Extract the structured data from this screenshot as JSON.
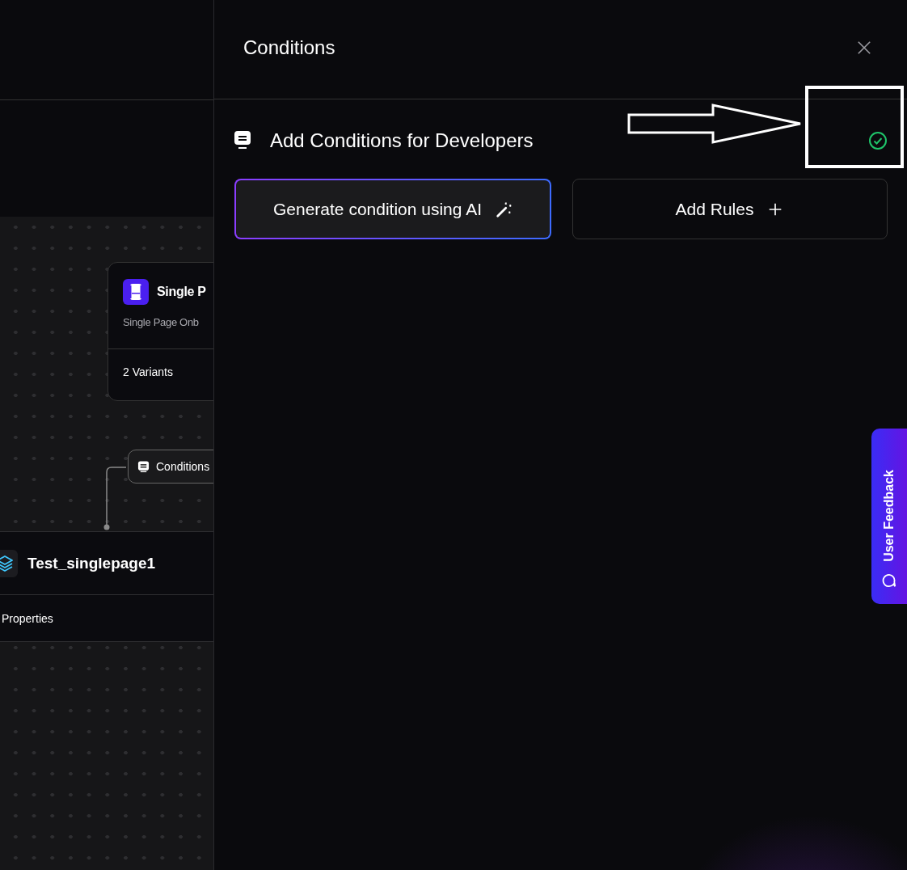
{
  "canvas": {
    "node": {
      "title": "Single P",
      "subtitle": "Single Page Onb",
      "variants": "2 Variants"
    },
    "condition_chip": {
      "label": "Conditions"
    },
    "flow": {
      "title": "Test_singlepage1",
      "tab": "Properties"
    }
  },
  "panel": {
    "title": "Conditions",
    "section": {
      "title": "Add Conditions for Developers",
      "valid": true
    },
    "buttons": [
      {
        "label": "Generate condition using AI",
        "kind": "ai"
      },
      {
        "label": "Add Rules",
        "kind": "add"
      }
    ]
  },
  "feedback_tab": {
    "label": "User Feedback"
  }
}
